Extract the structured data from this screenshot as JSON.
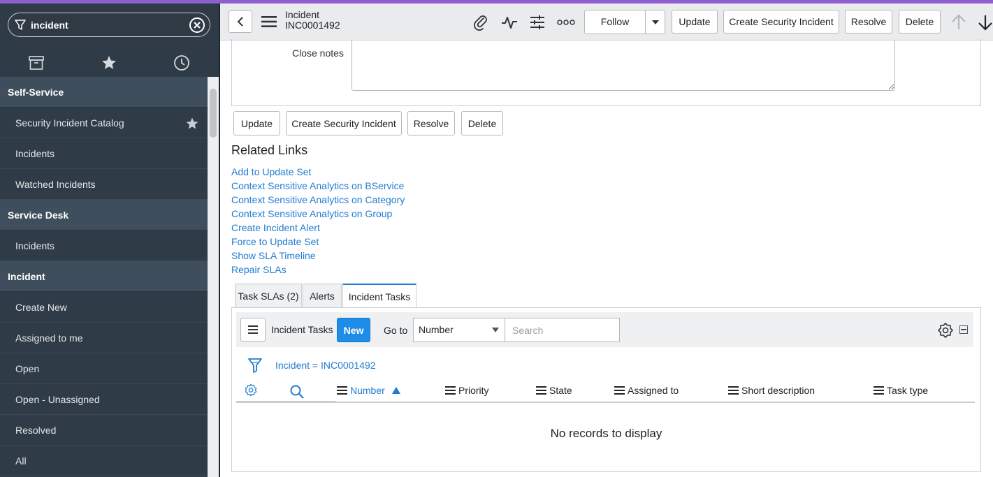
{
  "sidebar": {
    "filter_value": "incident",
    "sections": [
      {
        "title": "Self-Service",
        "items": [
          {
            "label": "Security Incident Catalog",
            "starred": true
          },
          {
            "label": "Incidents"
          },
          {
            "label": "Watched Incidents"
          }
        ]
      },
      {
        "title": "Service Desk",
        "items": [
          {
            "label": "Incidents"
          }
        ]
      },
      {
        "title": "Incident",
        "items": [
          {
            "label": "Create New"
          },
          {
            "label": "Assigned to me"
          },
          {
            "label": "Open"
          },
          {
            "label": "Open - Unassigned"
          },
          {
            "label": "Resolved"
          },
          {
            "label": "All"
          }
        ]
      }
    ]
  },
  "header": {
    "table": "Incident",
    "number": "INC0001492",
    "follow_label": "Follow",
    "buttons": {
      "update": "Update",
      "create_security": "Create Security Incident",
      "resolve": "Resolve",
      "delete": "Delete"
    }
  },
  "form": {
    "close_notes_label": "Close notes",
    "close_notes_value": "",
    "buttons": {
      "update": "Update",
      "create_security": "Create Security Incident",
      "resolve": "Resolve",
      "delete": "Delete"
    }
  },
  "related_links": {
    "title": "Related Links",
    "links": [
      "Add to Update Set",
      "Context Sensitive Analytics on BService",
      "Context Sensitive Analytics on Category",
      "Context Sensitive Analytics on Group",
      "Create Incident Alert",
      "Force to Update Set",
      "Show SLA Timeline",
      "Repair SLAs"
    ]
  },
  "related_lists": {
    "tabs": [
      "Task SLAs (2)",
      "Alerts",
      "Incident Tasks"
    ],
    "active_tab": "Incident Tasks",
    "list_title": "Incident Tasks",
    "new_label": "New",
    "goto_label": "Go to",
    "goto_field": "Number",
    "search_placeholder": "Search",
    "breadcrumb": "Incident = INC0001492",
    "columns": [
      "Number",
      "Priority",
      "State",
      "Assigned to",
      "Short description",
      "Task type"
    ],
    "sorted_column": "Number",
    "empty_message": "No records to display"
  },
  "colors": {
    "accent": "#8e5fd0",
    "sidebar_bg": "#2f3b46",
    "link": "#1f7bd1",
    "primary_button": "#1f8ce8"
  }
}
